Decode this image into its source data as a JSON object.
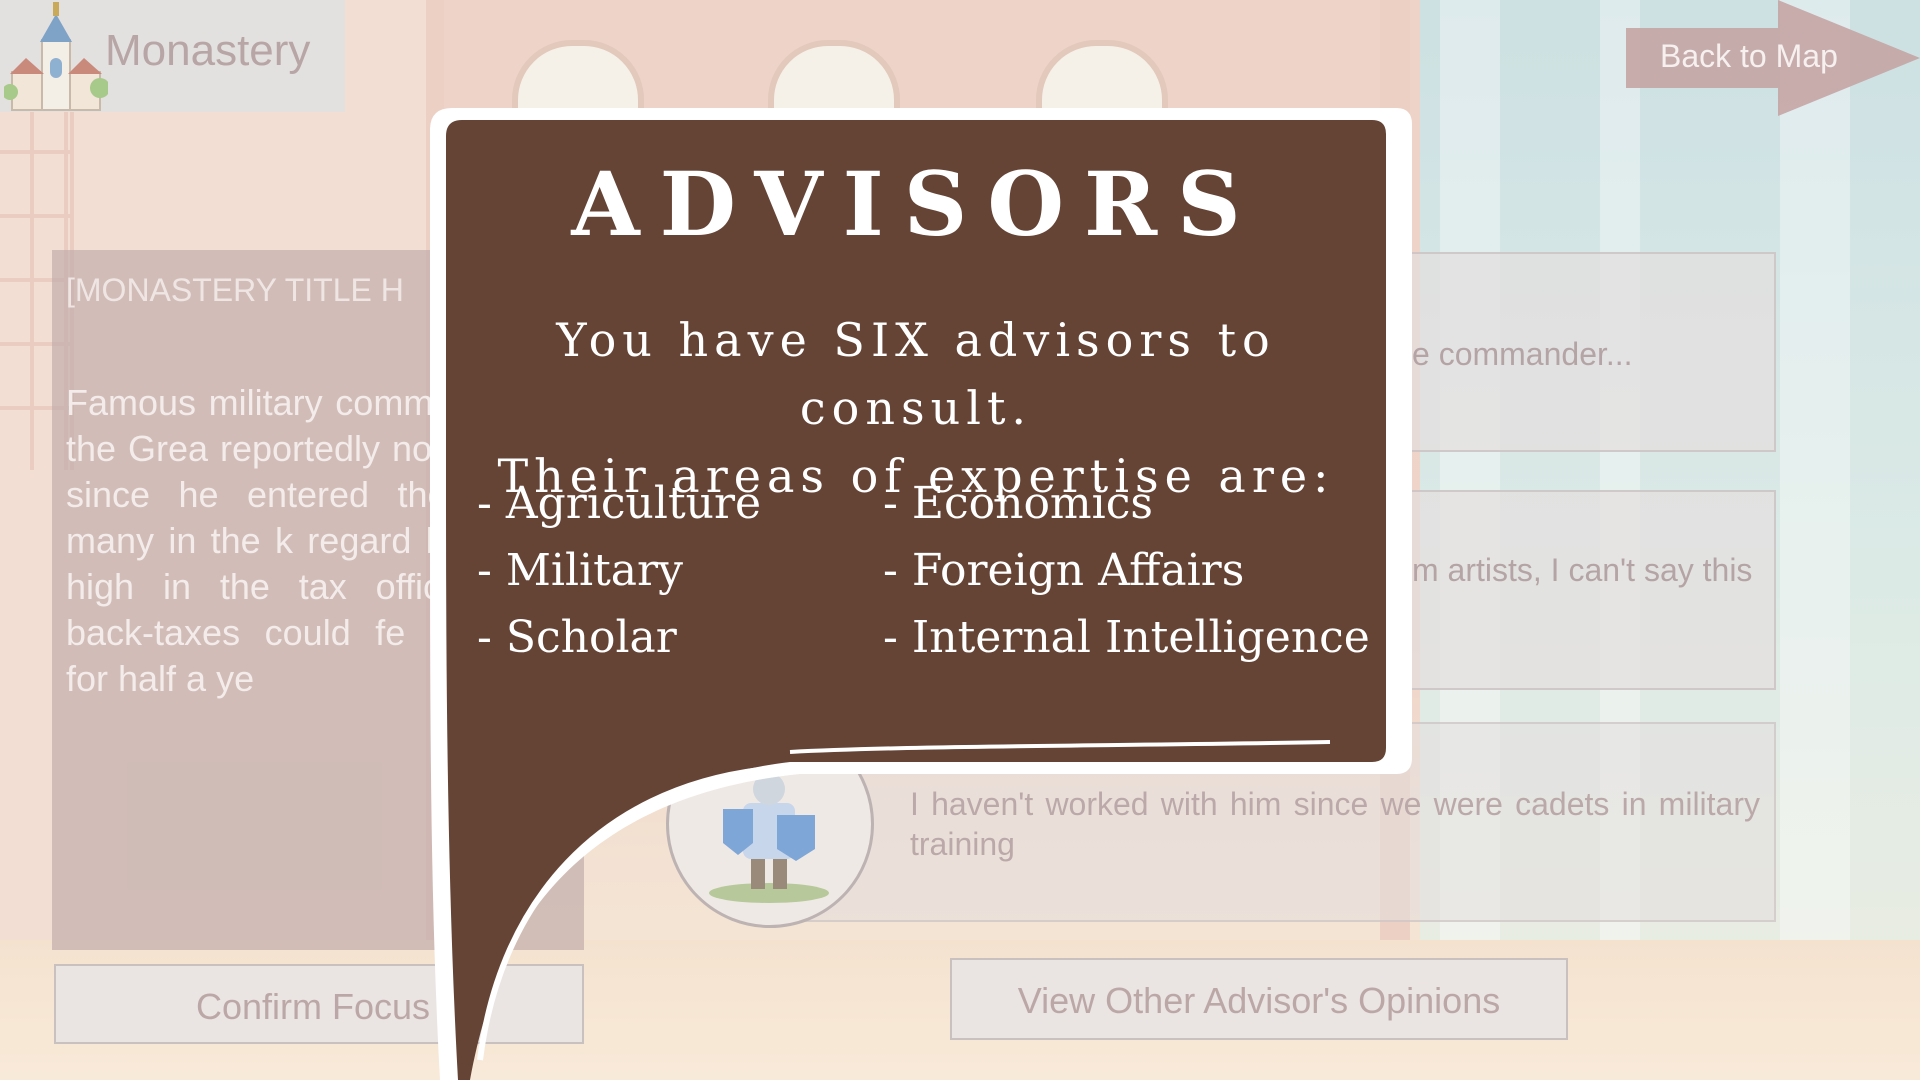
{
  "location": {
    "name": "Monastery"
  },
  "nav": {
    "back_label": "Back to Map"
  },
  "story": {
    "header": "[MONASTERY TITLE H",
    "body": "Famous military comm George the Grea reportedly not paid ar since he entered the While many in the k regard him very high in the tax office estin back-taxes could fe kingdom for half a ye"
  },
  "actions": {
    "confirm_label": "Confirm Focus",
    "view_opinions_label": "View Other Advisor's Opinions"
  },
  "opinions": [
    {
      "text": "e commander..."
    },
    {
      "text": "m artists, I can't say this"
    },
    {
      "text": "I haven't worked with him since we were cadets in military training"
    }
  ],
  "modal": {
    "title": "ADVISORS",
    "line1": "You have SIX advisors to consult.",
    "line2": "Their areas of expertise are:",
    "areas_left": [
      "- Agriculture",
      "- Military",
      "- Scholar"
    ],
    "areas_right": [
      "- Economics",
      "- Foreign Affairs",
      "- Internal Intelligence"
    ]
  },
  "colors": {
    "bubble": "#654435",
    "bubble_border": "#ffffff"
  }
}
